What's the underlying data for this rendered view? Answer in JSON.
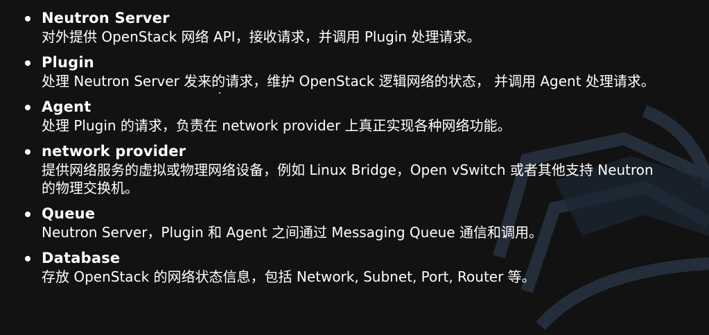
{
  "items": [
    {
      "term": "Neutron Server",
      "desc": "对外提供 OpenStack 网络 API，接收请求，并调用 Plugin 处理请求。"
    },
    {
      "term": "Plugin",
      "desc": "处理 Neutron Server 发来的请求，维护 OpenStack 逻辑网络的状态， 并调用 Agent 处理请求。"
    },
    {
      "term": "Agent",
      "desc": "处理 Plugin 的请求，负责在 network provider 上真正实现各种网络功能。"
    },
    {
      "term": "network provider",
      "desc": "提供网络服务的虚拟或物理网络设备，例如 Linux Bridge，Open vSwitch 或者其他支持 Neutron 的物理交换机。"
    },
    {
      "term": "Queue",
      "desc": "Neutron Server，Plugin 和 Agent 之间通过 Messaging Queue 通信和调用。"
    },
    {
      "term": "Database",
      "desc": "存放 OpenStack 的网络状态信息，包括 Network, Subnet, Port, Router 等。"
    }
  ],
  "colors": {
    "background": "#121212",
    "text": "#ffffff",
    "watermark": "#2a3848"
  },
  "icons": {
    "watermark": "openstack-logo-watermark"
  }
}
